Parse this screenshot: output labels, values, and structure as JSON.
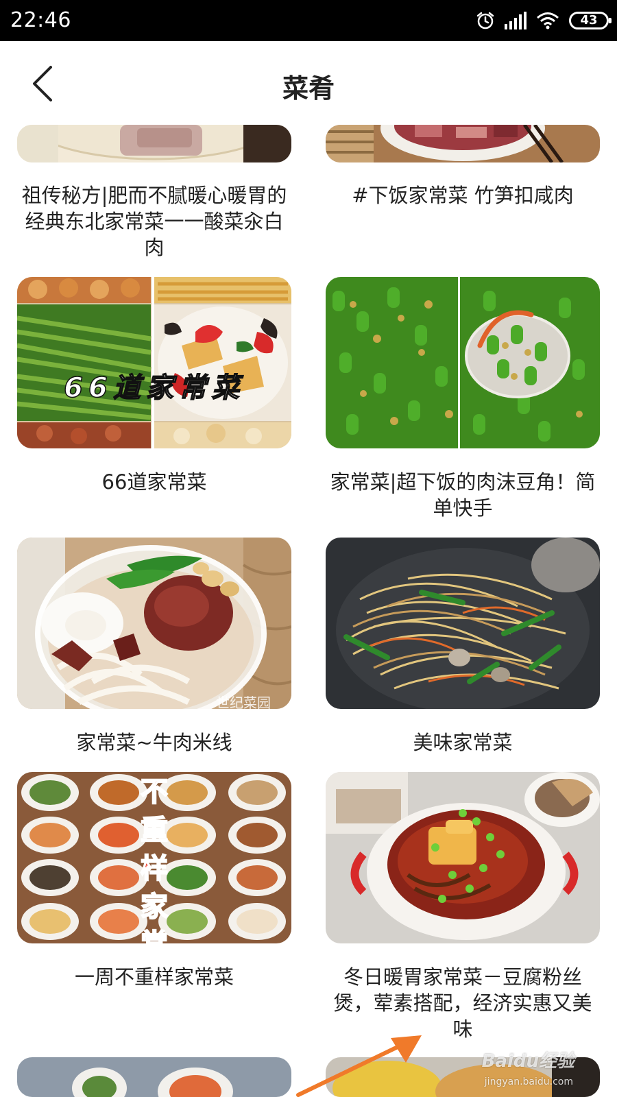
{
  "status_bar": {
    "time": "22:46",
    "battery": "43",
    "icons": [
      "alarm-icon",
      "signal-icon",
      "wifi-icon",
      "battery-icon"
    ]
  },
  "header": {
    "title": "菜肴",
    "back_icon": "chevron-left-icon"
  },
  "cards": [
    {
      "title": "祖传秘方|肥而不腻暖心暖胃的经典东北家常菜一一酸菜汆白肉"
    },
    {
      "title": "#下饭家常菜 竹笋扣咸肉"
    },
    {
      "title": "66道家常菜",
      "overlay": "66道家常菜"
    },
    {
      "title": "家常菜|超下饭的肉沫豆角！简单快手"
    },
    {
      "title": "家常菜~牛肉米线",
      "overlay": "世纪菜园"
    },
    {
      "title": "美味家常菜"
    },
    {
      "title": "一周不重样家常菜",
      "overlay": "不重样家常"
    },
    {
      "title": "冬日暖胃家常菜－豆腐粉丝煲，荤素搭配，经济实惠又美味"
    }
  ],
  "watermark": {
    "text": "Baidu经验",
    "sub": "jingyan.baidu.com"
  },
  "colors": {
    "status_bg": "#000000",
    "accent_arrow": "#f07a2a",
    "text": "#222222"
  }
}
